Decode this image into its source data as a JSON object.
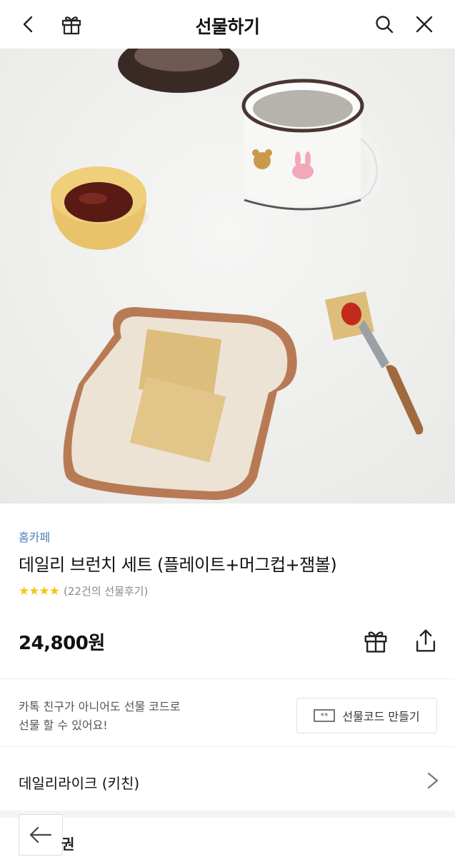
{
  "header": {
    "title": "선물하기",
    "icons": [
      "back-icon",
      "gift-icon",
      "search-icon",
      "close-icon"
    ]
  },
  "product": {
    "brand": "홈카페",
    "name": "데일리 브런치 세트 (플레이트+머그컵+잼볼)",
    "stars": "★★★★",
    "review_text": "(22건의 선물후기)",
    "price": "24,800원"
  },
  "gift_code": {
    "description_line1": "카톡 친구가 아니어도 선물 코드로",
    "description_line2": "선물 할 수 있어요!",
    "button_label": "선물코드 만들기"
  },
  "seller": {
    "label": "데일리라이크 (키친)"
  },
  "bottom": {
    "partial_text": "권"
  },
  "colors": {
    "brand_link": "#4a7fc1",
    "star": "#f5c518",
    "review_gray": "#8a8a8a"
  }
}
